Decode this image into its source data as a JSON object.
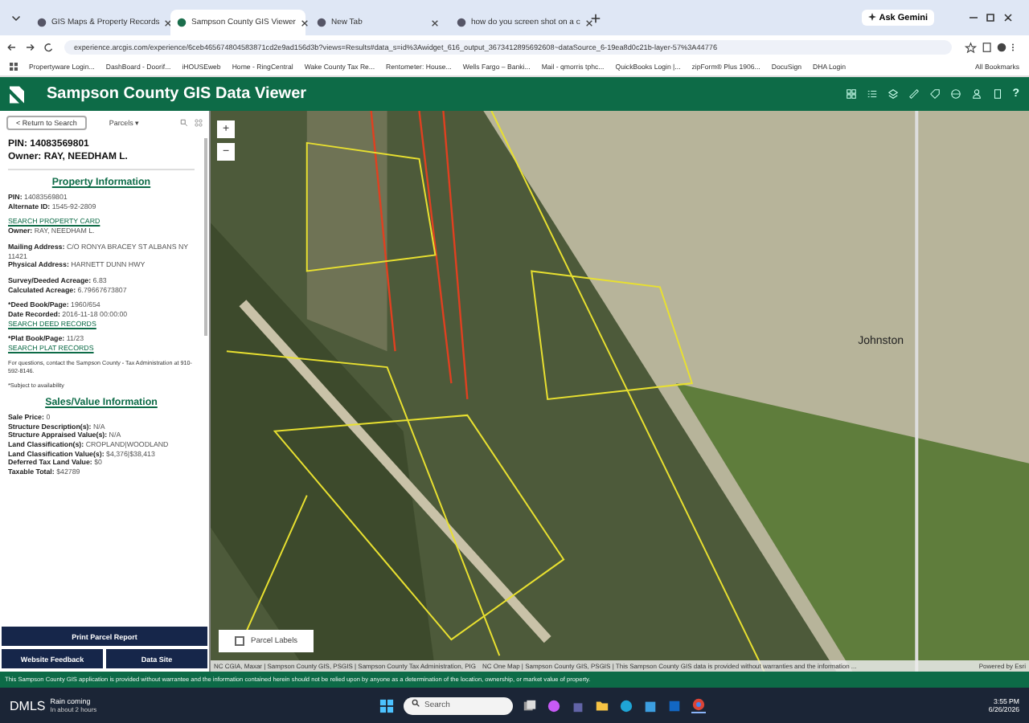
{
  "browser": {
    "tabs": [
      {
        "title": "GIS Maps & Property Records",
        "selected": false
      },
      {
        "title": "Sampson County GIS Viewer",
        "selected": true
      },
      {
        "title": "New Tab",
        "selected": false
      },
      {
        "title": "how do you screen shot on a c",
        "selected": false
      }
    ],
    "ask": "Ask Gemini",
    "url": "experience.arcgis.com/experience/6ceb465674804583871cd2e9ad156d3b?views=Results#data_s=id%3Awidget_616_output_3673412895692608~dataSource_6-19ea8d0c21b-layer-57%3A44776",
    "bookmarks": [
      "Propertyware Login...",
      "DashBoard - Doorif...",
      "iHOUSEweb",
      "Home - RingCentral",
      "Wake County Tax Re...",
      "Rentometer: House...",
      "Wells Fargo – Banki...",
      "Mail - qmorris tphc...",
      "QuickBooks Login |...",
      "zipForm® Plus 1906...",
      "DocuSign",
      "DHA Login"
    ],
    "all_bookmarks": "All Bookmarks"
  },
  "app": {
    "title": "Sampson County GIS Data Viewer",
    "help": "?"
  },
  "panel": {
    "back": "< Return to Search",
    "layer": "Parcels ▾",
    "pin": "PIN: 14083569801",
    "owner": "Owner: RAY, NEEDHAM L.",
    "sections": [
      {
        "heading": "Property Information",
        "blocks": [
          [
            {
              "kind": "field",
              "label": "PIN:",
              "value": "14083569801"
            },
            {
              "kind": "field",
              "label": "Alternate ID:",
              "value": "1545-92-2809"
            }
          ],
          [
            {
              "kind": "link",
              "text": "SEARCH PROPERTY CARD"
            },
            {
              "kind": "field",
              "label": "Owner:",
              "value": "RAY, NEEDHAM L."
            }
          ],
          [
            {
              "kind": "field",
              "label": "Mailing Address:",
              "value": "C/O RONYA BRACEY ST ALBANS NY 11421"
            },
            {
              "kind": "field",
              "label": "Physical Address:",
              "value": "HARNETT DUNN HWY"
            }
          ],
          [
            {
              "kind": "field",
              "label": "Survey/Deeded Acreage:",
              "value": "6.83"
            },
            {
              "kind": "field",
              "label": "Calculated Acreage:",
              "value": "6.79667673807"
            }
          ],
          [
            {
              "kind": "field",
              "label": "*Deed Book/Page:",
              "value": "1960/654"
            },
            {
              "kind": "field",
              "label": "Date Recorded:",
              "value": "2016-11-18 00:00:00"
            },
            {
              "kind": "link",
              "text": "SEARCH DEED RECORDS"
            }
          ],
          [
            {
              "kind": "field",
              "label": "*Plat Book/Page:",
              "value": "11/23"
            },
            {
              "kind": "link",
              "text": "SEARCH PLAT RECORDS"
            }
          ],
          [
            {
              "kind": "note",
              "text": "For questions, contact the Sampson County - Tax Administration at 910-592-8146."
            }
          ],
          [
            {
              "kind": "note",
              "text": "*Subject to availability"
            }
          ]
        ]
      },
      {
        "heading": "Sales/Value Information",
        "blocks": [
          [
            {
              "kind": "field",
              "label": "Sale Price:",
              "value": "0"
            },
            {
              "kind": "field",
              "label": "Structure Description(s):",
              "value": "N/A"
            },
            {
              "kind": "field",
              "label": "Structure Appraised Value(s):",
              "value": "N/A"
            },
            {
              "kind": "field",
              "label": "Land Classification(s):",
              "value": "CROPLAND|WOODLAND"
            },
            {
              "kind": "field",
              "label": "Land Classification Value(s):",
              "value": "$4,376|$38,413"
            },
            {
              "kind": "field",
              "label": "Deferred Tax Land Value:",
              "value": "$0"
            },
            {
              "kind": "field",
              "label": "Taxable Total:",
              "value": "$42789"
            }
          ]
        ]
      }
    ],
    "buttons": [
      "Print Parcel Report",
      "Website Feedback",
      "Data Site"
    ]
  },
  "map": {
    "zoom_in": "+",
    "zoom_out": "−",
    "place": "Johnston",
    "parcel_labels": {
      "label": "Parcel Labels",
      "checked": false
    },
    "attribution_left": "NC CGIA, Maxar | Sampson County GIS, PSGIS | Sampson County Tax Administration, PIG",
    "attribution_right": "NC One Map | Sampson County GIS, PSGIS | This Sampson County GIS data is provided without warranties and the information ...",
    "powered": "Powered by Esri"
  },
  "disclaimer": "This Sampson County GIS application is provided without warrantee and the information contained herein should not be relied upon by anyone as a determination of the location, ownership, or market value of property.",
  "taskbar": {
    "weather_temp": "DMLS",
    "weather_line1": "Rain coming",
    "weather_line2": "In about 2 hours",
    "search": "Search",
    "time": "3:55 PM",
    "date": "6/26/2026"
  }
}
